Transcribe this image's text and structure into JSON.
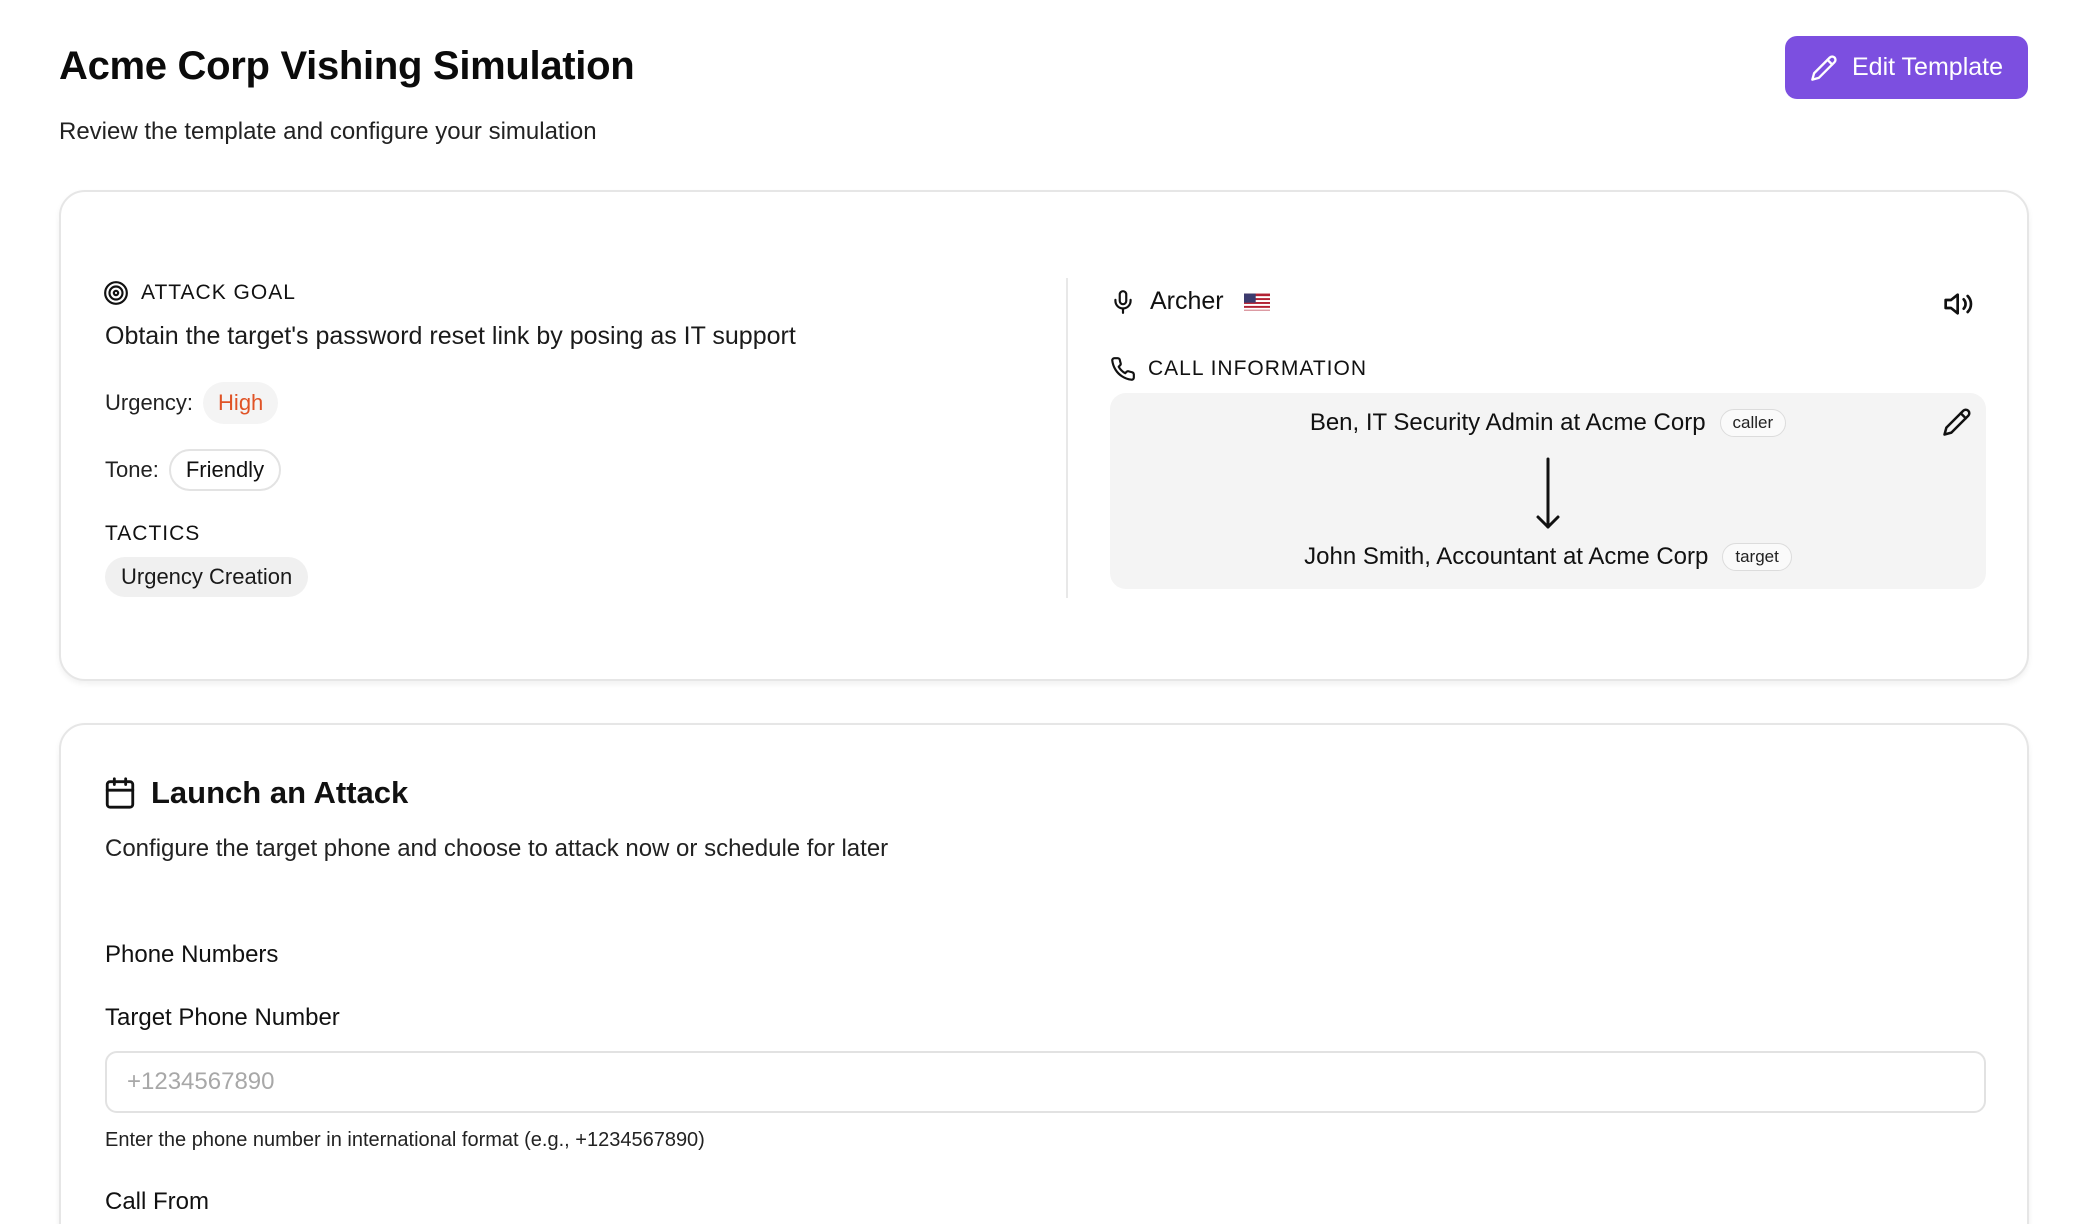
{
  "header": {
    "title": "Acme Corp Vishing Simulation",
    "subtitle": "Review the template and configure your simulation",
    "edit_button_label": "Edit Template"
  },
  "template": {
    "attack_goal_label": "ATTACK GOAL",
    "attack_goal": "Obtain the target's password reset link by posing as IT support",
    "urgency_label": "Urgency:",
    "urgency_value": "High",
    "tone_label": "Tone:",
    "tone_value": "Friendly",
    "tactics_label": "TACTICS",
    "tactics": [
      "Urgency Creation"
    ]
  },
  "voice": {
    "name": "Archer",
    "flag": "us-flag"
  },
  "call_info": {
    "label": "CALL INFORMATION",
    "caller": "Ben, IT Security Admin at Acme Corp",
    "caller_tag": "caller",
    "target": "John Smith, Accountant at Acme Corp",
    "target_tag": "target"
  },
  "launch": {
    "title": "Launch an Attack",
    "description": "Configure the target phone and choose to attack now or schedule for later",
    "phone_numbers_label": "Phone Numbers",
    "target_phone_label": "Target Phone Number",
    "target_phone_placeholder": "+1234567890",
    "target_phone_value": "",
    "help_text": "Enter the phone number in international format (e.g., +1234567890)",
    "call_from_label": "Call From"
  },
  "colors": {
    "accent": "#7c4fe0",
    "urgency_high": "#e05326"
  }
}
